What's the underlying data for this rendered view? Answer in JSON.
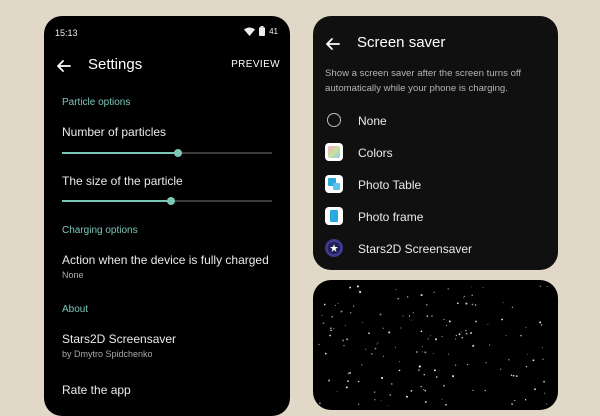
{
  "left_phone": {
    "status": {
      "time": "15:13",
      "battery": "41"
    },
    "title": "Settings",
    "preview_label": "PREVIEW",
    "sections": {
      "particle": "Particle options",
      "charging": "Charging options",
      "about": "About"
    },
    "items": {
      "particles_label": "Number of particles",
      "size_label": "The size of the particle",
      "action_label": "Action when the device is fully charged",
      "action_value": "None",
      "app_name": "Stars2D Screensaver",
      "app_author": "by Dmytro Spidchenko",
      "rate": "Rate the app"
    },
    "sliders": {
      "particles": 0.55,
      "size": 0.52
    },
    "accent": "#7cc6b8"
  },
  "screen_saver": {
    "title": "Screen saver",
    "description": "Show a screen saver after the screen turns off automatically while your phone is charging.",
    "options": [
      {
        "label": "None",
        "icon": "radio-empty-icon",
        "selected": false
      },
      {
        "label": "Colors",
        "icon": "colors-app-icon",
        "selected": false
      },
      {
        "label": "Photo Table",
        "icon": "photo-table-icon",
        "selected": false
      },
      {
        "label": "Photo frame",
        "icon": "photo-frame-icon",
        "selected": false
      },
      {
        "label": "Stars2D Screensaver",
        "icon": "stars2d-app-icon",
        "selected": false
      }
    ]
  }
}
